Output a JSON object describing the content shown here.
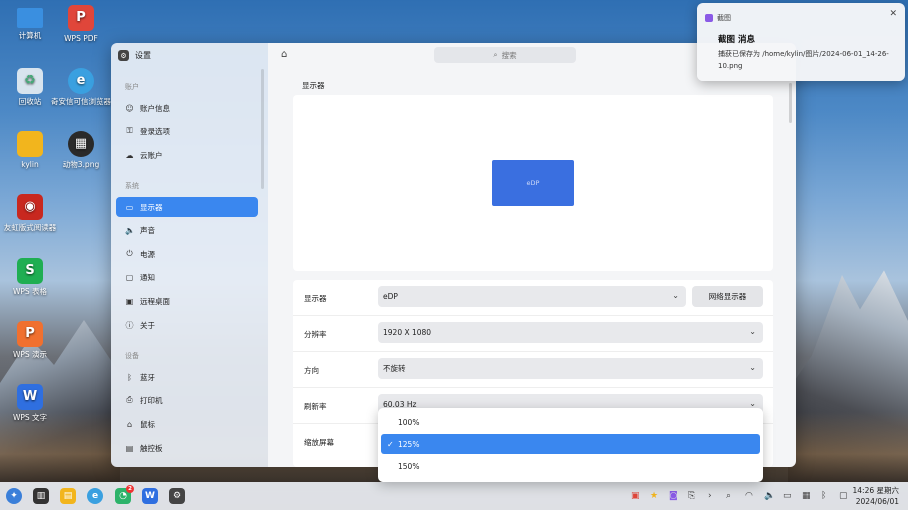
{
  "desktop": {
    "icons": [
      {
        "label": "计算机",
        "icon": "computer-icon",
        "color": "#3a8fe0"
      },
      {
        "label": "WPS PDF",
        "icon": "wps-pdf-icon",
        "color": "#e0463a"
      },
      {
        "label": "回收站",
        "icon": "trash-icon",
        "color": "#d8e4ee"
      },
      {
        "label": "奇安信可信浏览器",
        "icon": "browser-icon",
        "color": "#3aa0e0"
      },
      {
        "label": "kylin",
        "icon": "folder-icon",
        "color": "#f2b51d"
      },
      {
        "label": "动物3.png",
        "icon": "image-file-icon",
        "color": "#2a2a2a"
      },
      {
        "label": "友虹版式阅读器",
        "icon": "ofd-reader-icon",
        "color": "#c8281f"
      },
      {
        "label": "WPS 表格",
        "icon": "wps-sheet-icon",
        "color": "#1fae52"
      },
      {
        "label": "WPS 演示",
        "icon": "wps-slides-icon",
        "color": "#f0702f"
      },
      {
        "label": "WPS 文字",
        "icon": "wps-writer-icon",
        "color": "#2f6fe0"
      }
    ]
  },
  "window": {
    "title": "设置",
    "search_placeholder": "搜索",
    "sidebar": {
      "groups": [
        {
          "label": "账户",
          "items": [
            {
              "label": "账户信息",
              "icon": "user-icon"
            },
            {
              "label": "登录选项",
              "icon": "key-icon"
            },
            {
              "label": "云账户",
              "icon": "cloud-icon"
            }
          ]
        },
        {
          "label": "系统",
          "items": [
            {
              "label": "显示器",
              "icon": "monitor-icon"
            },
            {
              "label": "声音",
              "icon": "speaker-icon"
            },
            {
              "label": "电源",
              "icon": "power-icon"
            },
            {
              "label": "通知",
              "icon": "notification-icon"
            },
            {
              "label": "远程桌面",
              "icon": "remote-desktop-icon"
            },
            {
              "label": "关于",
              "icon": "info-icon"
            }
          ]
        },
        {
          "label": "设备",
          "items": [
            {
              "label": "蓝牙",
              "icon": "bluetooth-icon"
            },
            {
              "label": "打印机",
              "icon": "printer-icon"
            },
            {
              "label": "鼠标",
              "icon": "mouse-icon"
            },
            {
              "label": "触控板",
              "icon": "touchpad-icon"
            }
          ]
        }
      ],
      "active": "显示器"
    },
    "main": {
      "section_title": "显示器",
      "monitor_label": "eDP",
      "rows": {
        "display": {
          "label": "显示器",
          "value": "eDP",
          "button": "网络显示器"
        },
        "resolution": {
          "label": "分辨率",
          "value": "1920 X 1080"
        },
        "orientation": {
          "label": "方向",
          "value": "不旋转"
        },
        "refresh": {
          "label": "刷新率",
          "value": "60.03 Hz"
        },
        "scale": {
          "label": "缩放屏幕"
        }
      },
      "scale_options": [
        {
          "label": "100%",
          "selected": false
        },
        {
          "label": "125%",
          "selected": true
        },
        {
          "label": "150%",
          "selected": false
        }
      ]
    }
  },
  "notification": {
    "app": "截图",
    "title": "截图 消息",
    "body": "捕获已保存为 /home/kylin/图片/2024-06-01_14-26-10.png"
  },
  "taskbar": {
    "time": "14:26 星期六",
    "date": "2024/06/01",
    "chat_badge": "2"
  },
  "colors": {
    "accent": "#3a87ef",
    "monitor": "#3a6fe0"
  }
}
